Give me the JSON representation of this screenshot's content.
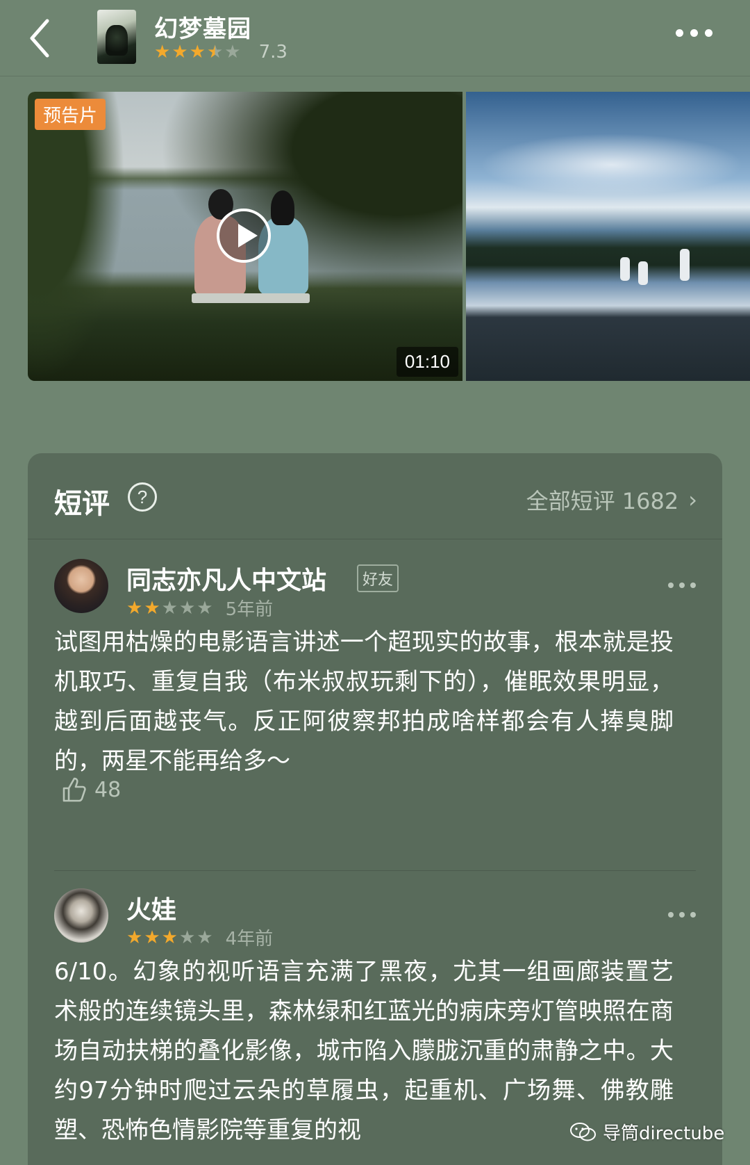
{
  "header": {
    "back_icon": "chevron-left-icon",
    "title": "幻梦墓园",
    "rating": {
      "stars": 3.5,
      "max": 5,
      "score": "7.3"
    },
    "more_icon": "more-horizontal-icon"
  },
  "media": {
    "trailer_badge": "预告片",
    "duration": "01:10",
    "play_icon": "play-icon"
  },
  "reviews_section": {
    "title": "短评",
    "help_icon": "question-circle-icon",
    "all_link": "全部短评 1682",
    "items": [
      {
        "user": "同志亦凡人中文站",
        "tag": "好友",
        "stars": 2,
        "date": "5年前",
        "text": "试图用枯燥的电影语言讲述一个超现实的故事，根本就是投机取巧、重复自我（布米叔叔玩剩下的），催眠效果明显，越到后面越丧气。反正阿彼察邦拍成啥样都会有人捧臭脚的，两星不能再给多～",
        "likes": "48"
      },
      {
        "user": "火娃",
        "stars": 3,
        "date": "4年前",
        "text": "6/10。幻象的视听语言充满了黑夜，尤其一组画廊装置艺术般的连续镜头里，森林绿和红蓝光的病床旁灯管映照在商场自动扶梯的叠化影像，城市陷入朦胧沉重的肃静之中。大约97分钟时爬过云朵的草履虫，起重机、广场舞、佛教雕塑、恐怖色情影院等重复的视"
      }
    ]
  },
  "watermark": "导筒directube",
  "colors": {
    "background": "#6f8571",
    "card": "#596b5b",
    "star": "#f3a92c",
    "badge": "#ec8b3a"
  }
}
